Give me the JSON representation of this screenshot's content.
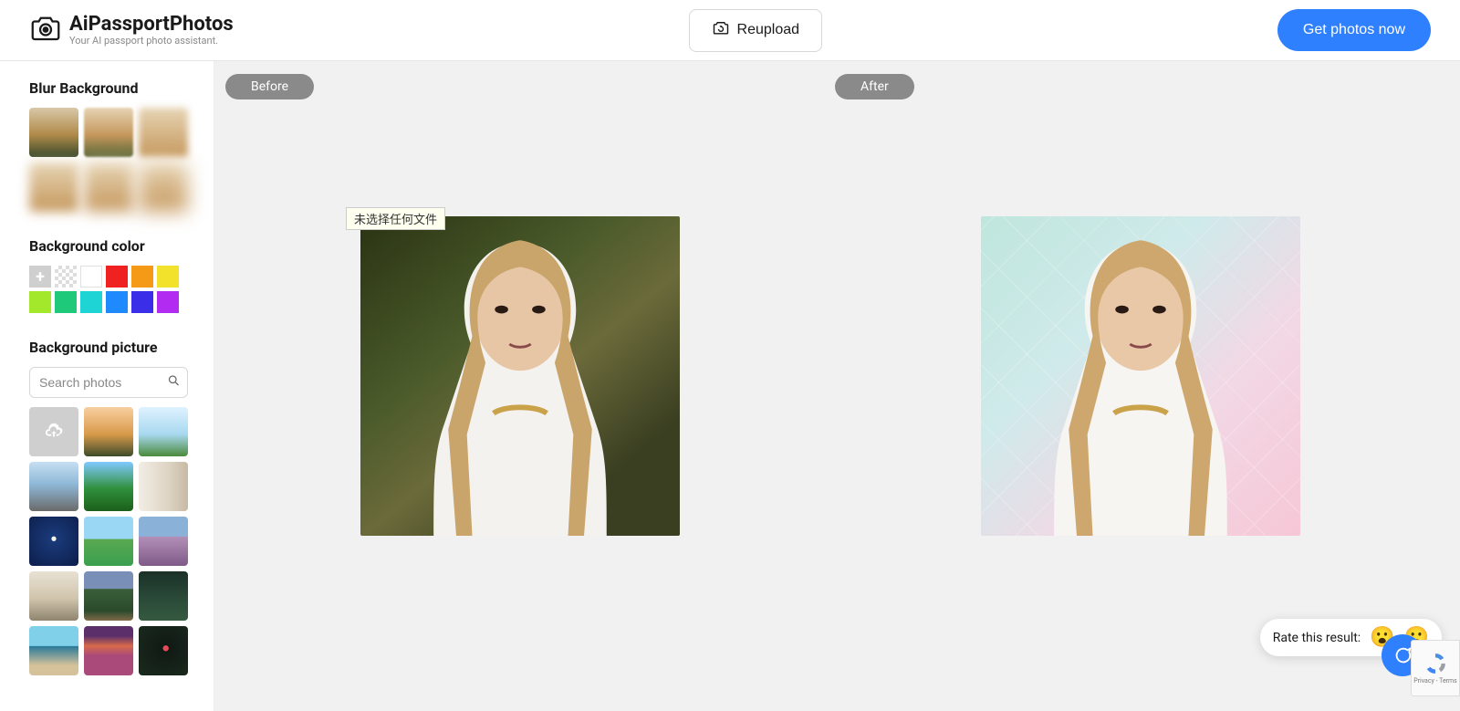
{
  "header": {
    "brand": "AiPassportPhotos",
    "tagline": "Your AI passport photo assistant.",
    "reupload_label": "Reupload",
    "cta_label": "Get photos now"
  },
  "sidebar": {
    "blur_title": "Blur Background",
    "color_title": "Background color",
    "picture_title": "Background picture",
    "search_placeholder": "Search photos",
    "colors": [
      {
        "name": "add",
        "v": ""
      },
      {
        "name": "transparent",
        "v": ""
      },
      {
        "name": "white",
        "v": "#ffffff"
      },
      {
        "name": "red",
        "v": "#f02121"
      },
      {
        "name": "orange",
        "v": "#f59a16"
      },
      {
        "name": "yellow",
        "v": "#f2e22b"
      },
      {
        "name": "lime",
        "v": "#a4e82b"
      },
      {
        "name": "green",
        "v": "#1fc97a"
      },
      {
        "name": "cyan",
        "v": "#1fd4d4"
      },
      {
        "name": "blue",
        "v": "#1f8aff"
      },
      {
        "name": "indigo",
        "v": "#3a2ee8"
      },
      {
        "name": "purple",
        "v": "#b22bf0"
      }
    ]
  },
  "canvas": {
    "before_label": "Before",
    "after_label": "After",
    "tooltip": "未选择任何文件"
  },
  "rate": {
    "prompt": "Rate this result:",
    "good_emoji": "😮",
    "bad_emoji": "🙁"
  },
  "recaptcha": {
    "privacy": "Privacy",
    "terms": "Terms"
  }
}
